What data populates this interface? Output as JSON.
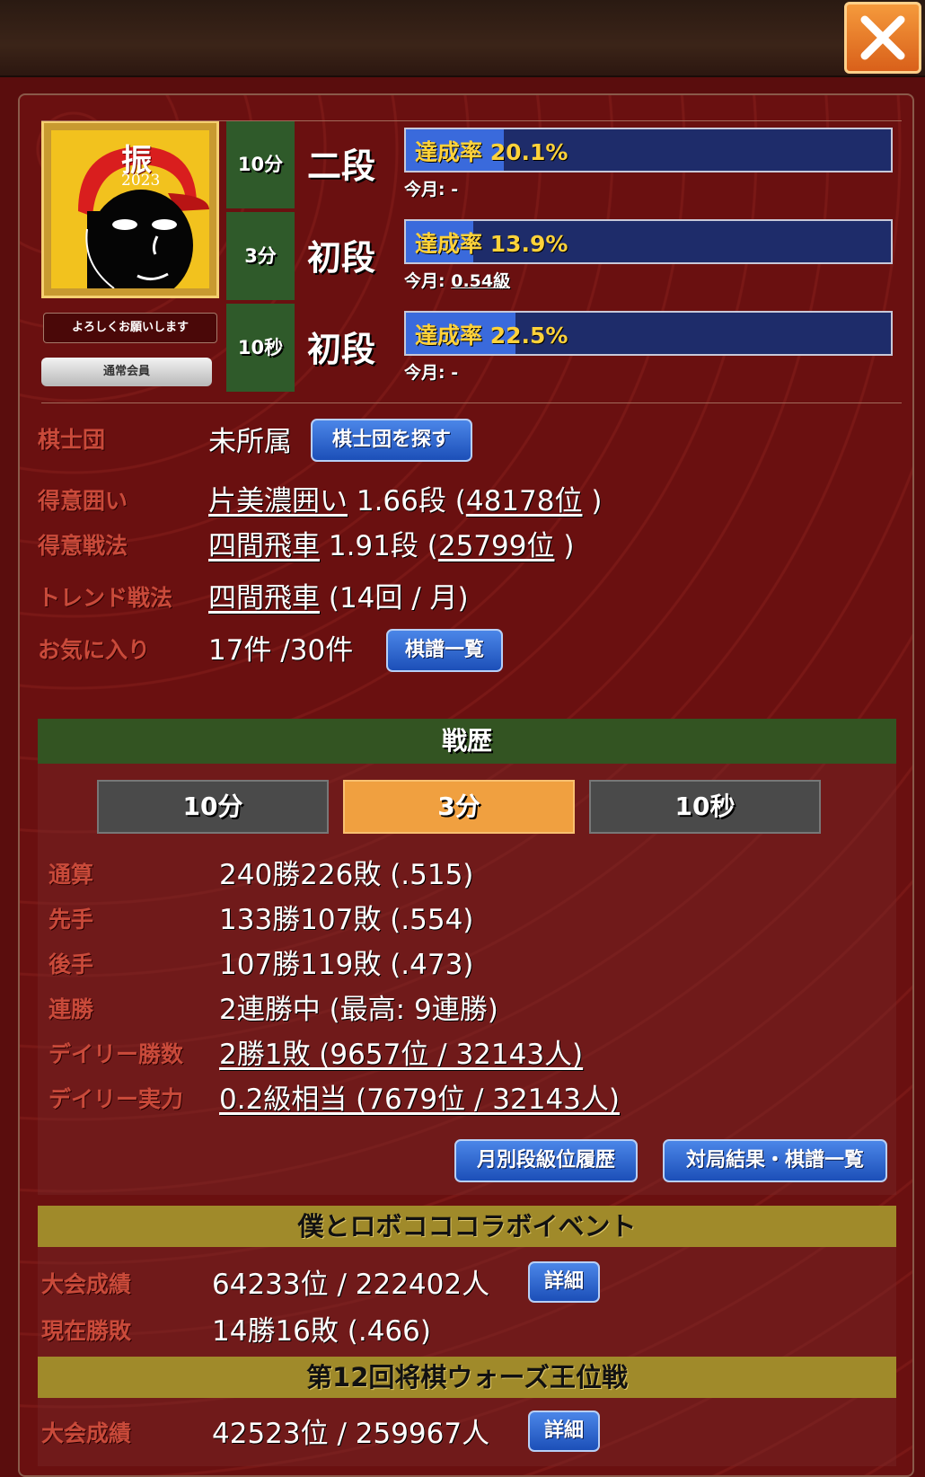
{
  "header": {
    "close_label": "×"
  },
  "profile": {
    "cap_text": "振",
    "cap_year": "2023",
    "greeting": "よろしくお願いします",
    "membership": "通常会員"
  },
  "ranks": [
    {
      "time": "10分",
      "rank": "二段",
      "rate_label": "達成率 20.1%",
      "rate": 0.201,
      "month_label": "今月:",
      "month_value": "-"
    },
    {
      "time": "3分",
      "rank": "初段",
      "rate_label": "達成率 13.9%",
      "rate": 0.139,
      "month_label": "今月:",
      "month_value": "0.54級"
    },
    {
      "time": "10秒",
      "rank": "初段",
      "rate_label": "達成率 22.5%",
      "rate": 0.225,
      "month_label": "今月:",
      "month_value": "-"
    }
  ],
  "info": {
    "team_label": "棋士団",
    "team_value": "未所属",
    "team_button": "棋士団を探す",
    "castle_label": "得意囲い",
    "castle_name": "片美濃囲い",
    "castle_rank": "1.66段 (",
    "castle_pos": "48178位",
    "castle_close": " )",
    "strategy_label": "得意戦法",
    "strategy_name": "四間飛車",
    "strategy_rank": "1.91段 (",
    "strategy_pos": "25799位",
    "strategy_close": " )",
    "trend_label": "トレンド戦法",
    "trend_name": "四間飛車",
    "trend_rest": "(14回 / 月)",
    "fav_label": "お気に入り",
    "fav_value": "17件 /30件",
    "fav_button": "棋譜一覧"
  },
  "history": {
    "title": "戦歴",
    "tabs": [
      "10分",
      "3分",
      "10秒"
    ],
    "active_tab": 1,
    "rows": [
      {
        "label": "通算",
        "value": "240勝226敗 (.515)",
        "link": false
      },
      {
        "label": "先手",
        "value": "133勝107敗 (.554)",
        "link": false
      },
      {
        "label": "後手",
        "value": "107勝119敗 (.473)",
        "link": false
      },
      {
        "label": "連勝",
        "value": "2連勝中 (最高: 9連勝)",
        "link": false
      },
      {
        "label": "デイリー勝数",
        "value": "2勝1敗 (9657位 / 32143人)",
        "link": true
      },
      {
        "label": "デイリー実力",
        "value": "0.2級相当 (7679位 / 32143人)",
        "link": true
      }
    ],
    "monthly_button": "月別段級位履歴",
    "results_button": "対局結果・棋譜一覧"
  },
  "events": [
    {
      "title": "僕とロボコココラボイベント",
      "rows": [
        {
          "label": "大会成績",
          "value": "64233位 / 222402人",
          "button": "詳細"
        },
        {
          "label": "現在勝敗",
          "value": "14勝16敗 (.466)"
        }
      ]
    },
    {
      "title": "第12回将棋ウォーズ王位戦",
      "rows": [
        {
          "label": "大会成績",
          "value": "42523位 / 259967人",
          "button": "詳細"
        }
      ]
    }
  ],
  "colors": {
    "bg": "#5a0d0d",
    "label": "#c94a3a",
    "bar": "#3a6adc",
    "rate_text": "#ffd23a",
    "accent_tab": "#f0a040"
  }
}
